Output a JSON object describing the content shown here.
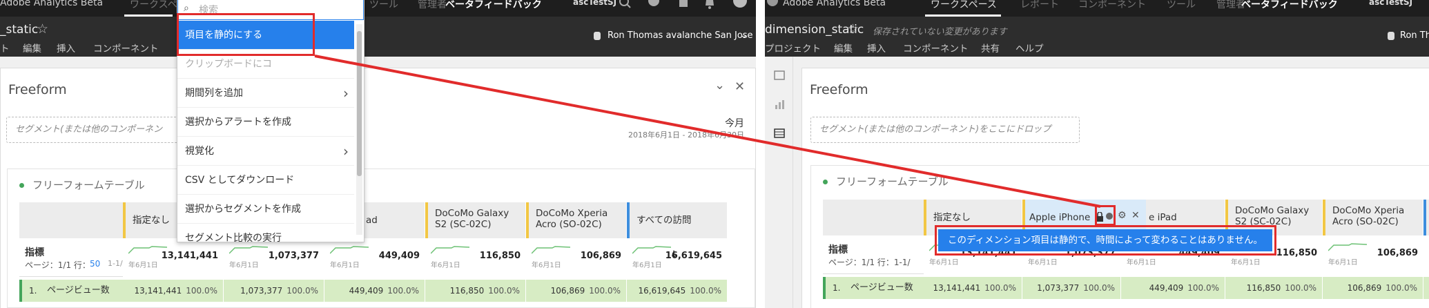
{
  "left": {
    "app_title": "Adobe Analytics Beta",
    "top_dim_left": "ワークスペース",
    "top_dim_right": "ツール",
    "admin": "管理者",
    "feedback": "ベータフィードバック",
    "user": "ascTestSJ",
    "project_title": "_static",
    "menu": [
      "ト",
      "編集",
      "挿入",
      "コンポーネント"
    ],
    "report_suite": "Ron Thomas avalanche San Jose",
    "panel_title": "Freeform",
    "segment_placeholder": "セグメント(または他のコンポーネン",
    "date_label": "今月",
    "date_range": "2018年6月1日 - 2018年6月30日",
    "table_title": "フリーフォームテーブル",
    "columns": [
      "指定なし",
      "",
      "ad",
      "DoCoMo Galaxy S2 (SC-02C)",
      "DoCoMo Xperia Acro (SO-02C)",
      "すべての訪問"
    ],
    "metric_label": "指標",
    "page_info": "ページ：1/1 行：",
    "page_rows": "50",
    "page_range": "1-1/",
    "spark_label": "年6月1日",
    "totals": [
      "13,141,441",
      "1,073,377",
      "449,409",
      "116,850",
      "106,869",
      "16,619,645"
    ],
    "row_num": "1.",
    "row_label": "ページビュー数",
    "row_values": [
      "13,141,441",
      "1,073,377",
      "449,409",
      "116,850",
      "106,869",
      "16,619,645"
    ],
    "row_pcts": [
      "100.0%",
      "100.0%",
      "100.0%",
      "100.0%",
      "100.0%",
      "100.0%"
    ]
  },
  "context_menu": {
    "search_placeholder": "検索",
    "items": [
      {
        "label": "項目を静的にする"
      },
      {
        "label": "クリップボードにコ"
      },
      {
        "label": "期間列を追加"
      },
      {
        "label": "選択からアラートを作成"
      },
      {
        "label": "視覚化"
      },
      {
        "label": "CSV としてダウンロード"
      },
      {
        "label": "選択からセグメントを作成"
      },
      {
        "label": "セグメント比較の実行"
      }
    ]
  },
  "right": {
    "app_title": "Adobe Analytics Beta",
    "nav": [
      "ワークスペース",
      "レポート",
      "コンポーネント",
      "ツール"
    ],
    "admin": "管理者",
    "feedback": "ベータフィードバック",
    "user": "ascTestSJ",
    "project_title": "dimension_static",
    "unsaved": "保存されていない変更があります",
    "menu": [
      "プロジェクト",
      "編集",
      "挿入",
      "コンポーネント",
      "共有",
      "ヘルプ"
    ],
    "report_suite": "Ron Th",
    "panel_title": "Freeform",
    "segment_placeholder": "セグメント(または他のコンポーネント)をここにドロップ",
    "table_title": "フリーフォームテーブル",
    "columns": [
      "指定なし",
      "Apple iPhone",
      "e iPad",
      "DoCoMo Galaxy S2 (SC-02C)",
      "DoCoMo Xperia Acro (SO-02C)"
    ],
    "metric_label": "指標",
    "page_info": "ページ：1/1 行：1-1/",
    "spark_label": "年6月1日",
    "totals": [
      "13,141,441",
      "1,073,377",
      "449,409",
      "116,850",
      "106,869"
    ],
    "row_num": "1.",
    "row_label": "ページビュー数",
    "row_values": [
      "13,141,441",
      "1,073,377",
      "449,409",
      "116,850",
      "106,869"
    ],
    "row_pcts": [
      "100.0%",
      "100.0%",
      "100.0%",
      "100.0%",
      "100.0%"
    ],
    "tooltip": "このディメンション項目は静的で、時間によって変わることはありません。"
  },
  "colors": {
    "accent_blue": "#2680eb",
    "annotation_red": "#e12b2b",
    "row_green": "#d7ecc4",
    "col_yellow": "#f2c744"
  }
}
